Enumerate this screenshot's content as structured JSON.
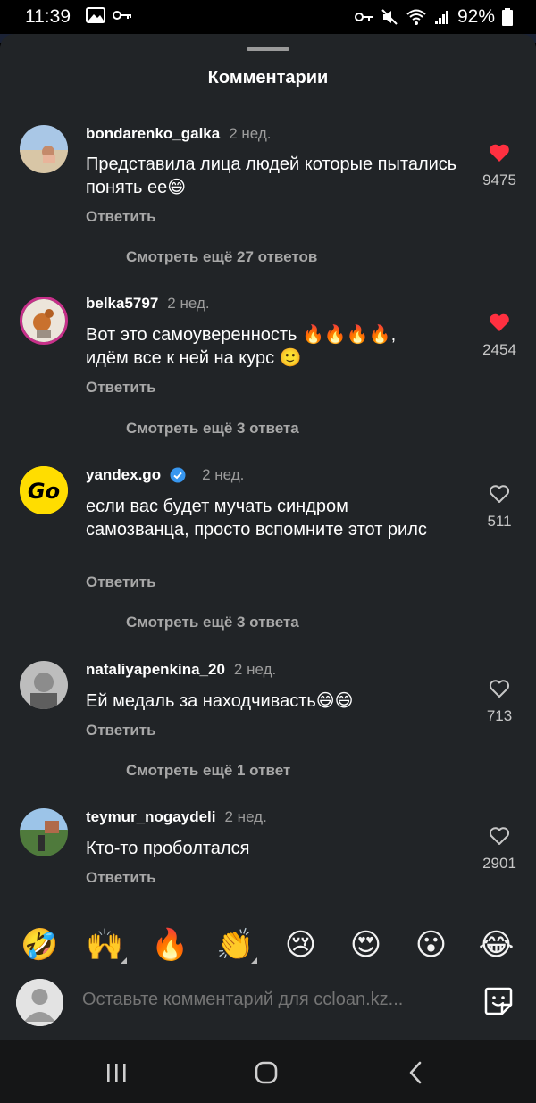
{
  "status_bar": {
    "time": "11:39",
    "battery": "92%"
  },
  "sheet": {
    "title": "Комментарии"
  },
  "comments": [
    {
      "username": "bondarenko_galka",
      "time": "2 нед.",
      "text": "Представила лица людей которые пытались понять ее😄",
      "reply_label": "Ответить",
      "likes": "9475",
      "liked": true,
      "view_more": "Смотреть ещё 27 ответов"
    },
    {
      "username": "belka5797",
      "time": "2 нед.",
      "text": "Вот это самоуверенность 🔥🔥🔥🔥, идём все к ней на курс 🙂",
      "reply_label": "Ответить",
      "likes": "2454",
      "liked": true,
      "view_more": "Смотреть ещё 3 ответа"
    },
    {
      "username": "yandex.go",
      "verified": true,
      "time": "2 нед.",
      "text": "если вас будет мучать синдром самозванца, просто вспомните этот рилс",
      "reply_label": "Ответить",
      "likes": "511",
      "liked": false,
      "view_more": "Смотреть ещё 3 ответа"
    },
    {
      "username": "nataliyapenkina_20",
      "time": "2 нед.",
      "text": "Ей медаль за находчивасть😄😄",
      "reply_label": "Ответить",
      "likes": "713",
      "liked": false,
      "view_more": "Смотреть ещё 1 ответ"
    },
    {
      "username": "teymur_nogaydeli",
      "time": "2 нед.",
      "text": "Кто-то проболтался",
      "reply_label": "Ответить",
      "likes": "2901",
      "liked": false
    }
  ],
  "emoji_bar": [
    "🤣",
    "🙌",
    "🔥",
    "👏",
    "😢",
    "😍",
    "😮",
    "😂"
  ],
  "comment_input": {
    "placeholder": "Оставьте комментарий для ccloan.kz..."
  },
  "colors": {
    "sheet_bg": "#212427",
    "like_red": "#ff3040",
    "verified_blue": "#3897f0",
    "yandex_yellow": "#ffdd00"
  }
}
